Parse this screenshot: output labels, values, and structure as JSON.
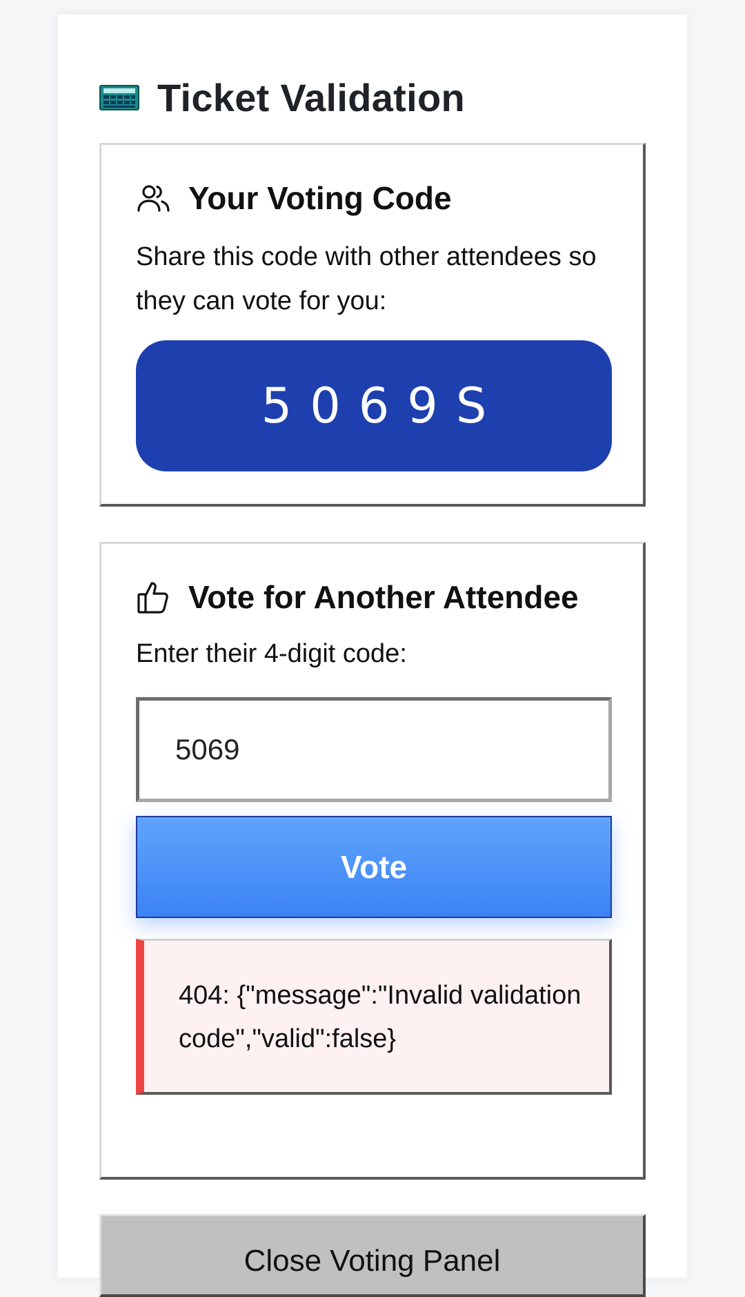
{
  "page": {
    "title": "Ticket Validation",
    "title_icon": "calculator-icon"
  },
  "voting_code": {
    "heading": "Your Voting Code",
    "heading_icon": "users-icon",
    "description": "Share this code with other attendees so they can vote for you:",
    "code": "5069S"
  },
  "vote_other": {
    "heading": "Vote for Another Attendee",
    "heading_icon": "thumbs-up-icon",
    "prompt": "Enter their 4-digit code:",
    "input_value": "5069",
    "vote_label": "Vote",
    "error_message": "404: {\"message\":\"Invalid validation code\",\"valid\":false}"
  },
  "footer": {
    "close_label": "Close Voting Panel"
  },
  "colors": {
    "code_bg": "#1e40af",
    "vote_button": "#3b82f6",
    "error_accent": "#ef4444",
    "error_bg": "#fef1f1"
  }
}
